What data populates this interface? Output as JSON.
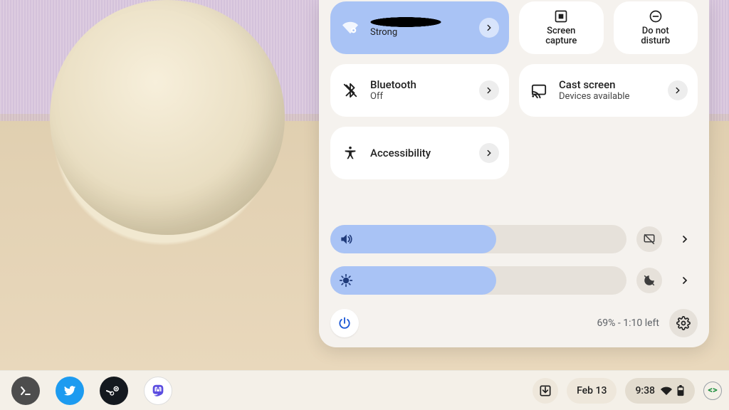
{
  "colors": {
    "accent": "#a9c3f5",
    "panel": "#f5f2ee",
    "shelf": "#f4f0e8"
  },
  "panel": {
    "wifi": {
      "name_redacted": true,
      "signal_label": "Strong"
    },
    "screencap": {
      "line1": "Screen",
      "line2": "capture"
    },
    "dnd": {
      "line1": "Do not",
      "line2": "disturb"
    },
    "bluetooth": {
      "title": "Bluetooth",
      "status": "Off"
    },
    "cast": {
      "title": "Cast screen",
      "status": "Devices available"
    },
    "a11y": {
      "title": "Accessibility"
    },
    "volume_pct": 56,
    "brightness_pct": 56,
    "battery_status": "69% - 1:10 left"
  },
  "shelf": {
    "apps": [
      "terminal",
      "twitter",
      "steam",
      "mastodon"
    ],
    "date": "Feb 13",
    "time": "9:38"
  }
}
